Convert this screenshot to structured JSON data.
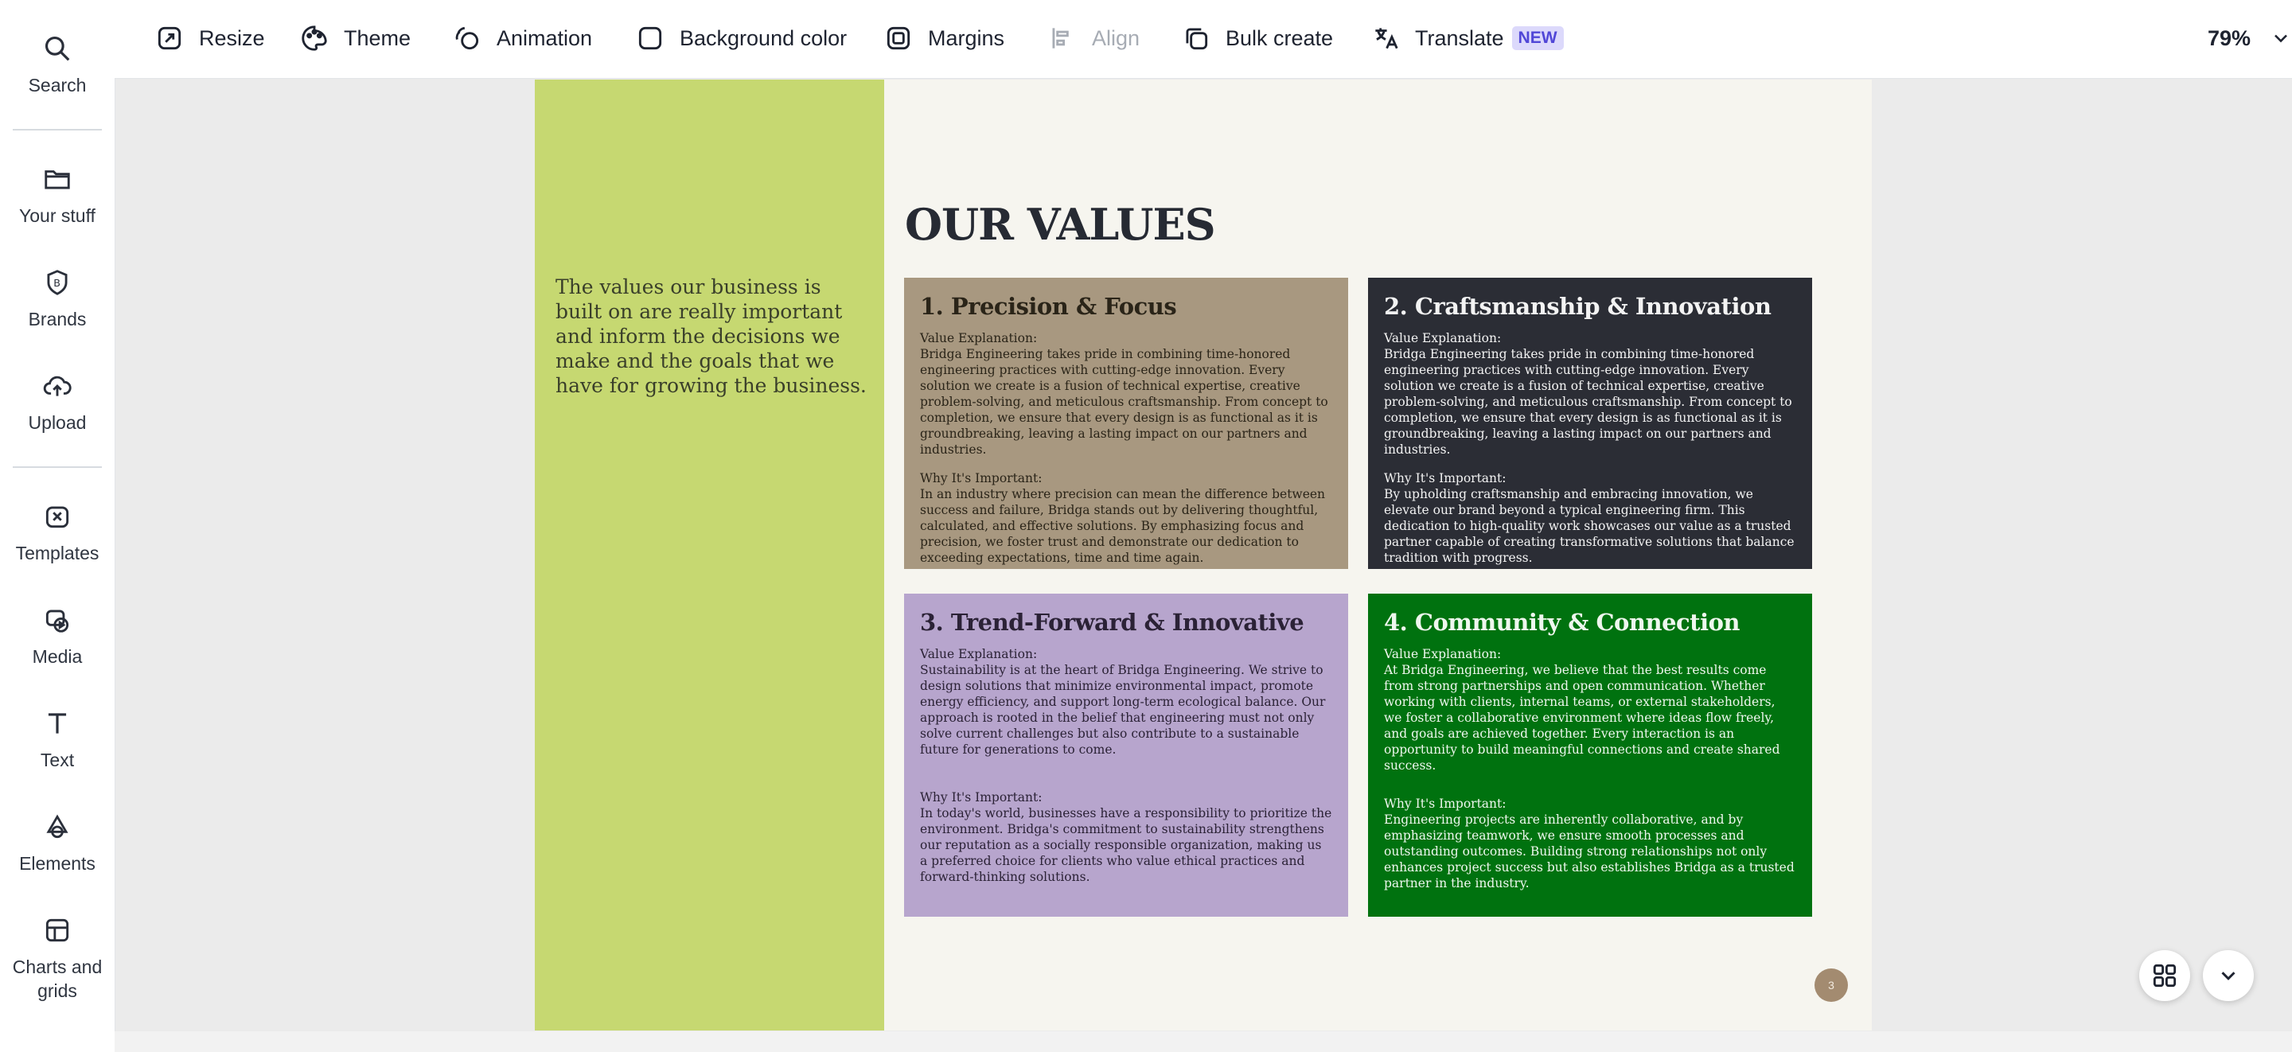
{
  "sidebar": {
    "items": [
      {
        "label": "Search",
        "icon": "search-icon"
      },
      {
        "label": "Your stuff",
        "icon": "folder-icon"
      },
      {
        "label": "Brands",
        "icon": "brand-icon"
      },
      {
        "label": "Upload",
        "icon": "upload-icon"
      },
      {
        "label": "Templates",
        "icon": "templates-icon"
      },
      {
        "label": "Media",
        "icon": "media-icon"
      },
      {
        "label": "Text",
        "icon": "text-icon"
      },
      {
        "label": "Elements",
        "icon": "elements-icon"
      },
      {
        "label": "Charts and grids",
        "icon": "charts-grids-icon"
      }
    ]
  },
  "toolbar": {
    "resize": "Resize",
    "theme": "Theme",
    "animation": "Animation",
    "background_color": "Background color",
    "margins": "Margins",
    "align": "Align",
    "bulk_create": "Bulk create",
    "translate": "Translate",
    "translate_badge": "NEW",
    "zoom": "79%"
  },
  "slide": {
    "title": "OUR VALUES",
    "intro": "The values our business is built on are really important and inform the decisions we make and the goals that we have for growing the business.",
    "page_number": "3",
    "cards": [
      {
        "title": "1. Precision & Focus",
        "value_heading": "Value Explanation:",
        "value_text": "Bridga Engineering takes pride in combining time-honored engineering practices with cutting-edge innovation. Every solution we create is a fusion of technical expertise, creative problem-solving, and meticulous craftsmanship. From concept to completion, we ensure that every design is as functional as it is groundbreaking, leaving a lasting impact on our partners and industries.",
        "why_heading": "Why It's Important:",
        "why_text": "In an industry where precision can mean the difference between success and failure, Bridga stands out by delivering thoughtful, calculated, and effective solutions. By emphasizing focus and precision, we foster trust and demonstrate our dedication to exceeding expectations, time and time again."
      },
      {
        "title": "2. Craftsmanship & Innovation",
        "value_heading": "Value Explanation:",
        "value_text": "Bridga Engineering takes pride in combining time-honored engineering practices with cutting-edge innovation. Every solution we create is a fusion of technical expertise, creative problem-solving, and meticulous craftsmanship. From concept to completion, we ensure that every design is as functional as it is groundbreaking, leaving a lasting impact on our partners and industries.",
        "why_heading": "Why It's Important:",
        "why_text": "By upholding craftsmanship and embracing innovation, we elevate our brand beyond a typical engineering firm. This dedication to high-quality work showcases our value as a trusted partner capable of creating transformative solutions that balance tradition with progress."
      },
      {
        "title": "3. Trend-Forward & Innovative",
        "value_heading": "Value Explanation:",
        "value_text": "Sustainability is at the heart of Bridga Engineering. We strive to design solutions that minimize environmental impact, promote energy efficiency, and support long-term ecological balance. Our approach is rooted in the belief that engineering must not only solve current challenges but also contribute to a sustainable future for generations to come.",
        "why_heading": "Why It's Important:",
        "why_text": "In today's world, businesses have a responsibility to prioritize the environment. Bridga's commitment to sustainability strengthens our reputation as a socially responsible organization, making us a preferred choice for clients who value ethical practices and forward-thinking solutions."
      },
      {
        "title": "4. Community & Connection",
        "value_heading": "Value Explanation:",
        "value_text": "At Bridga Engineering, we believe that the best results come from strong partnerships and open communication. Whether working with clients, internal teams, or external stakeholders, we foster a collaborative environment where ideas flow freely, and goals are achieved together. Every interaction is an opportunity to build meaningful connections and create shared success.",
        "why_heading": "Why It's Important:",
        "why_text": "Engineering projects are inherently collaborative, and by emphasizing teamwork, we ensure smooth processes and outstanding outcomes. Building strong relationships not only enhances project success but also establishes Bridga as a trusted partner in the industry."
      }
    ]
  },
  "colors": {
    "green_band": "#c6d871",
    "card1": "#a89880",
    "card2": "#2b2d35",
    "card3": "#b7a5cd",
    "card4": "#00720f",
    "badge_bg": "#dcd9fb"
  }
}
